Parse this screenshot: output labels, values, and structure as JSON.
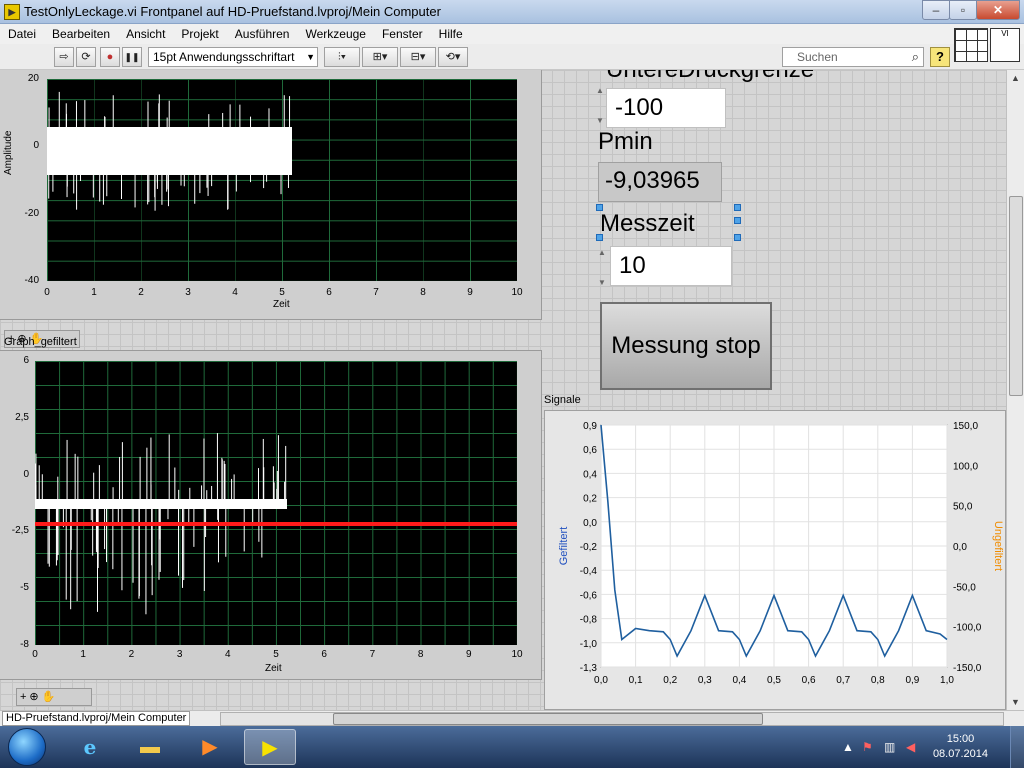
{
  "window": {
    "title": "TestOnlyLeckage.vi Frontpanel auf HD-Pruefstand.lvproj/Mein Computer",
    "app_icon": "labview-vi-icon",
    "minimize": "–",
    "maximize": "▫",
    "close": "✕"
  },
  "menu": [
    "Datei",
    "Bearbeiten",
    "Ansicht",
    "Projekt",
    "Ausführen",
    "Werkzeuge",
    "Fenster",
    "Hilfe"
  ],
  "toolbar": {
    "run": "⇨",
    "run_continuously": "⟳",
    "abort": "●",
    "pause": "❚❚",
    "font": "15pt Anwendungsschriftart",
    "font_arrow": "▼",
    "align": "⫶▾",
    "distribute": "⊞▾",
    "resize": "⊟▾",
    "reorder": "⟲▾",
    "search_placeholder": "Suchen",
    "search_icon": "⌕",
    "help": "?"
  },
  "graph_top": {
    "label": "",
    "ylabel": "Amplitude",
    "xlabel": "Zeit",
    "yticks": [
      "20",
      "0",
      "-20",
      "-40"
    ],
    "xticks": [
      "0",
      "1",
      "2",
      "3",
      "4",
      "5",
      "6",
      "7",
      "8",
      "9",
      "10"
    ],
    "palette": "+⊕✋"
  },
  "graph_filtered": {
    "label": "Graph_gefiltert",
    "xlabel": "Zeit",
    "yticks": [
      "6",
      "2,5",
      "0",
      "-2,5",
      "-5",
      "-8"
    ],
    "xticks": [
      "0",
      "1",
      "2",
      "3",
      "4",
      "5",
      "6",
      "7",
      "8",
      "9",
      "10"
    ],
    "palette": "+⊕✋"
  },
  "controls": {
    "untere_label": "UntereDruckgrenze",
    "untere_value": "-100",
    "pmin_label": "Pmin",
    "pmin_value": "-9,03965",
    "messzeit_label": "Messzeit",
    "messzeit_value": "10",
    "stop_button": "Messung stop"
  },
  "signals_chart": {
    "label": "Signale",
    "left_axis_label": "Gefiltert",
    "right_axis_label": "Ungefiltert",
    "left_ticks": [
      "0,9",
      "0,6",
      "0,4",
      "0,2",
      "0,0",
      "-0,2",
      "-0,4",
      "-0,6",
      "-0,8",
      "-1,0",
      "-1,3"
    ],
    "right_ticks": [
      "150,0",
      "100,0",
      "50,0",
      "0,0",
      "-50,0",
      "-100,0",
      "-150,0"
    ],
    "xticks": [
      "0,0",
      "0,1",
      "0,2",
      "0,3",
      "0,4",
      "0,5",
      "0,6",
      "0,7",
      "0,8",
      "0,9",
      "1,0"
    ],
    "left_color": "#1f4fbf",
    "right_color": "#f08c00",
    "trace_color": "#1f5f9f"
  },
  "chart_data": {
    "type": "line",
    "x": [
      0.0,
      0.02,
      0.04,
      0.06,
      0.1,
      0.14,
      0.18,
      0.2,
      0.22,
      0.26,
      0.3,
      0.34,
      0.38,
      0.4,
      0.42,
      0.46,
      0.5,
      0.54,
      0.58,
      0.6,
      0.62,
      0.66,
      0.7,
      0.74,
      0.78,
      0.8,
      0.82,
      0.86,
      0.9,
      0.94,
      0.98,
      1.0
    ],
    "series": [
      {
        "values": [
          0.9,
          0.2,
          -0.6,
          -1.05,
          -0.95,
          -0.97,
          -0.98,
          -1.05,
          -1.2,
          -0.97,
          -0.65,
          -0.97,
          -0.98,
          -1.05,
          -1.2,
          -0.97,
          -0.65,
          -0.97,
          -0.98,
          -1.05,
          -1.2,
          -0.97,
          -0.65,
          -0.97,
          -0.98,
          -1.05,
          -1.2,
          -0.97,
          -0.65,
          -0.97,
          -1.0,
          -1.05
        ]
      }
    ],
    "xlim": [
      0,
      1
    ],
    "ylim": [
      -1.3,
      0.9
    ],
    "grid": true
  },
  "status": {
    "path": "HD-Pruefstand.lvproj/Mein Computer"
  },
  "taskbar": {
    "clock_time": "15:00",
    "clock_date": "08.07.2014",
    "tray_up_arrow": "▲",
    "icons": [
      "ie-icon",
      "explorer-icon",
      "media-player-icon",
      "labview-icon"
    ]
  }
}
